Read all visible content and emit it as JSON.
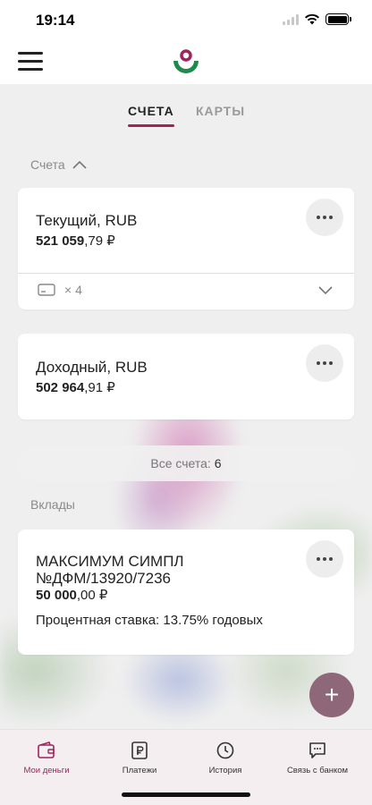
{
  "status_bar": {
    "time": "19:14"
  },
  "tabs": [
    {
      "label": "СЧЕТА",
      "active": true
    },
    {
      "label": "КАРТЫ",
      "active": false
    }
  ],
  "accounts_section": {
    "label": "Счета"
  },
  "accounts": [
    {
      "title": "Текущий, RUB",
      "amount_whole": "521 059",
      "amount_frac": ",79 ₽",
      "cards_count": "× 4"
    },
    {
      "title": "Доходный, RUB",
      "amount_whole": "502 964",
      "amount_frac": ",91 ₽"
    }
  ],
  "all_accounts": {
    "label": "Все счета:",
    "count": "6"
  },
  "deposits_section": {
    "label": "Вклады"
  },
  "deposit": {
    "title_line1": "МАКСИМУМ СИМПЛ",
    "title_line2": "№ДФМ/13920/7236",
    "amount_whole": "50 000",
    "amount_frac": ",00 ₽",
    "rate": "Процентная ставка: 13.75% годовых"
  },
  "fab": {
    "label": "+"
  },
  "bottom_nav": [
    {
      "label": "Мои деньги",
      "icon": "wallet-icon",
      "active": true
    },
    {
      "label": "Платежи",
      "icon": "ruble-document-icon",
      "active": false
    },
    {
      "label": "История",
      "icon": "clock-icon",
      "active": false
    },
    {
      "label": "Связь с банком",
      "icon": "chat-icon",
      "active": false
    }
  ],
  "colors": {
    "accent": "#a0235e",
    "fab": "#8e6779",
    "logo_green": "#1e8a4c"
  }
}
